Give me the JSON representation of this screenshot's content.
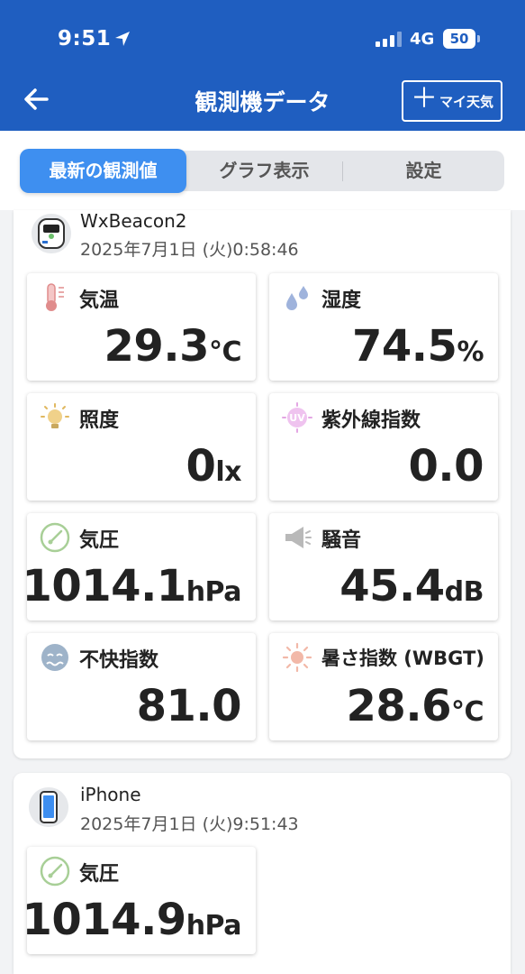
{
  "status_bar": {
    "time": "9:51",
    "network": "4G",
    "battery": "50"
  },
  "header": {
    "title": "観測機データ",
    "my_weather_button": "マイ天気"
  },
  "tabs": [
    {
      "label": "最新の観測値",
      "active": true
    },
    {
      "label": "グラフ表示",
      "active": false
    },
    {
      "label": "設定",
      "active": false
    }
  ],
  "devices": [
    {
      "name": "WxBeacon2",
      "timestamp": "2025年7月1日 (火)0:58:46",
      "readings": [
        {
          "label": "気温",
          "value": "29.3",
          "unit": "°C",
          "icon": "thermometer-icon"
        },
        {
          "label": "湿度",
          "value": "74.5",
          "unit": "%",
          "icon": "water-drops-icon"
        },
        {
          "label": "照度",
          "value": "0",
          "unit": "lx",
          "icon": "light-bulb-icon"
        },
        {
          "label": "紫外線指数",
          "value": "0.0",
          "unit": "",
          "icon": "uv-icon"
        },
        {
          "label": "気圧",
          "value": "1014.1",
          "unit": "hPa",
          "icon": "gauge-icon"
        },
        {
          "label": "騒音",
          "value": "45.4",
          "unit": "dB",
          "icon": "megaphone-icon"
        },
        {
          "label": "不快指数",
          "value": "81.0",
          "unit": "",
          "icon": "discomfort-face-icon"
        },
        {
          "label": "暑さ指数 (WBGT)",
          "value": "28.6",
          "unit": "°C",
          "icon": "sun-icon"
        }
      ]
    },
    {
      "name": "iPhone",
      "timestamp": "2025年7月1日 (火)9:51:43",
      "readings": [
        {
          "label": "気圧",
          "value": "1014.9",
          "unit": "hPa",
          "icon": "gauge-icon"
        }
      ]
    }
  ],
  "colors": {
    "header_blue": "#1f5ec0",
    "active_tab": "#3e8ff0"
  }
}
